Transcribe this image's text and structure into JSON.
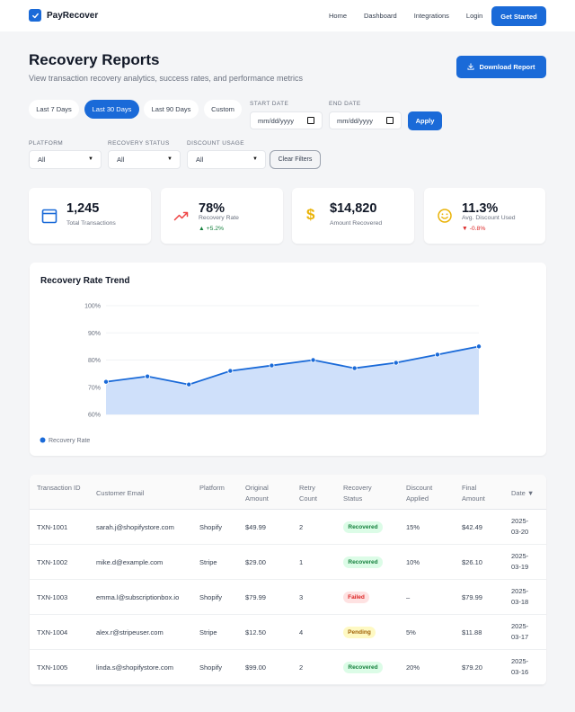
{
  "app": {
    "name": "PayRecover",
    "brand_color": "#1a6ad8"
  },
  "nav": {
    "links": [
      "Home",
      "Dashboard",
      "Integrations",
      "Login"
    ],
    "cta": "Get Started"
  },
  "header": {
    "title": "Recovery Reports",
    "subtitle": "View transaction recovery analytics, success rates, and performance metrics",
    "download_label": "Download Report"
  },
  "range": {
    "options": [
      "Last 7 Days",
      "Last 30 Days",
      "Last 90 Days",
      "Custom"
    ],
    "active": "Last 30 Days"
  },
  "dates": {
    "start_label": "START DATE",
    "start_placeholder": "mm/dd/yyyy",
    "end_label": "END DATE",
    "end_placeholder": "mm/dd/yyyy",
    "apply_label": "Apply"
  },
  "filters": {
    "platform": {
      "label": "PLATFORM",
      "value": "All"
    },
    "status": {
      "label": "RECOVERY STATUS",
      "value": "All"
    },
    "discount": {
      "label": "DISCOUNT USAGE",
      "value": "All"
    },
    "clear_label": "Clear Filters"
  },
  "stats": [
    {
      "value": "1,245",
      "label": "Total Transactions",
      "icon": "calendar-icon"
    },
    {
      "value": "78%",
      "label": "Recovery Rate",
      "delta": "▲ +5.2%",
      "delta_color": "#15803d",
      "icon": "trend-up-icon"
    },
    {
      "value": "$14,820",
      "label": "Amount Recovered",
      "icon": "dollar-icon"
    },
    {
      "value": "11.3%",
      "label": "Avg. Discount Used",
      "delta": "▼ -0.8%",
      "delta_color": "#dc2626",
      "icon": "smile-icon"
    }
  ],
  "chart": {
    "title": "Recovery Rate Trend",
    "legend": "Recovery Rate"
  },
  "chart_data": {
    "type": "area",
    "title": "Recovery Rate Trend",
    "ytick_labels": [
      "100%",
      "90%",
      "80%",
      "70%",
      "60%"
    ],
    "ylim": [
      60,
      100
    ],
    "series": [
      {
        "name": "Recovery Rate",
        "values": [
          72,
          74,
          71,
          76,
          78,
          80,
          77,
          79,
          82,
          85
        ]
      }
    ],
    "legend_position": "bottom-left",
    "grid": true,
    "colors": {
      "line": "#1a6ad8",
      "fill": "#cfe0fa"
    }
  },
  "table": {
    "headers": [
      "Transaction ID",
      "Customer Email",
      "Platform",
      "Original Amount",
      "Retry Count",
      "Recovery Status",
      "Discount Applied",
      "Final Amount",
      "Date ▼"
    ],
    "rows": [
      [
        "TXN-1001",
        "sarah.j@shopifystore.com",
        "Shopify",
        "$49.99",
        "2",
        "Recovered",
        "15%",
        "$42.49",
        "2025-03-20"
      ],
      [
        "TXN-1002",
        "mike.d@example.com",
        "Stripe",
        "$29.00",
        "1",
        "Recovered",
        "10%",
        "$26.10",
        "2025-03-19"
      ],
      [
        "TXN-1003",
        "emma.l@subscriptionbox.io",
        "Shopify",
        "$79.99",
        "3",
        "Failed",
        "–",
        "$79.99",
        "2025-03-18"
      ],
      [
        "TXN-1004",
        "alex.r@stripeuser.com",
        "Stripe",
        "$12.50",
        "4",
        "Pending",
        "5%",
        "$11.88",
        "2025-03-17"
      ],
      [
        "TXN-1005",
        "linda.s@shopifystore.com",
        "Shopify",
        "$99.00",
        "2",
        "Recovered",
        "20%",
        "$79.20",
        "2025-03-16"
      ]
    ],
    "status_colors": {
      "Recovered": {
        "bg": "#dcfce7",
        "fg": "#15803d"
      },
      "Failed": {
        "bg": "#fee2e2",
        "fg": "#dc2626"
      },
      "Pending": {
        "bg": "#fef9c3",
        "fg": "#a16207"
      }
    }
  }
}
